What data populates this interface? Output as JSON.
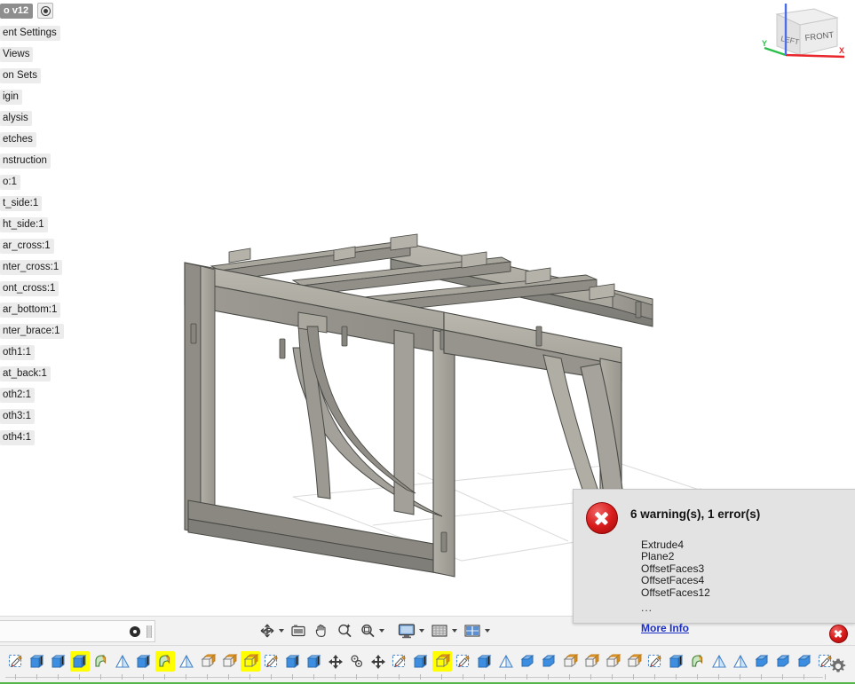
{
  "document": {
    "title": "o v12",
    "version_badge_icon": "record-dot-icon"
  },
  "browser": {
    "items": [
      {
        "label": "ent Settings",
        "icon": "gear-icon"
      },
      {
        "label": "Views",
        "icon": "named-views-icon"
      },
      {
        "label": "on Sets",
        "icon": "selection-sets-icon"
      },
      {
        "label": "igin",
        "icon": "origin-icon"
      },
      {
        "label": "alysis",
        "icon": "analysis-icon"
      },
      {
        "label": "etches",
        "icon": "sketches-icon"
      },
      {
        "label": "nstruction",
        "icon": "construction-icon"
      },
      {
        "label": "o:1",
        "icon": "component-icon"
      },
      {
        "label": "t_side:1",
        "icon": "component-icon"
      },
      {
        "label": "ht_side:1",
        "icon": "component-icon"
      },
      {
        "label": "ar_cross:1",
        "icon": "component-icon"
      },
      {
        "label": "nter_cross:1",
        "icon": "component-icon"
      },
      {
        "label": "ont_cross:1",
        "icon": "component-icon"
      },
      {
        "label": "ar_bottom:1",
        "icon": "component-icon"
      },
      {
        "label": "nter_brace:1",
        "icon": "component-icon"
      },
      {
        "label": "oth1:1",
        "icon": "component-icon"
      },
      {
        "label": "at_back:1",
        "icon": "component-icon"
      },
      {
        "label": "oth2:1",
        "icon": "component-icon"
      },
      {
        "label": "oth3:1",
        "icon": "component-icon"
      },
      {
        "label": "oth4:1",
        "icon": "component-icon"
      }
    ]
  },
  "viewcube": {
    "face_left_label": "LEFT",
    "face_front_label": "FRONT",
    "axis_x_label": "X",
    "axis_y_label": "Y",
    "axis_x_color": "#e8262b",
    "axis_y_color": "#2bbf4a",
    "axis_z_color": "#4a6fe8"
  },
  "error_dialog": {
    "title": "6 warning(s), 1 error(s)",
    "items": [
      "Extrude4",
      "Plane2",
      "OffsetFaces3",
      "OffsetFaces4",
      "OffsetFaces12"
    ],
    "ellipsis": "...",
    "more_info_label": "More Info",
    "badge_icon": "error-x-icon",
    "link_color": "#1b2ec4",
    "error_color": "#d81b1b"
  },
  "status_bar": {
    "error_badge_icon": "error-x-icon"
  },
  "navigation_bar": {
    "buttons": [
      {
        "name": "orbit",
        "icon": "orbit-icon",
        "has_caret": true
      },
      {
        "name": "look-at",
        "icon": "look-at-icon",
        "has_caret": false
      },
      {
        "name": "pan",
        "icon": "pan-hand-icon",
        "has_caret": false
      },
      {
        "name": "zoom",
        "icon": "zoom-magnifier-icon",
        "has_caret": false
      },
      {
        "name": "fit",
        "icon": "fit-magnifier-icon",
        "has_caret": true
      },
      {
        "name": "display-settings",
        "icon": "monitor-icon",
        "has_caret": true
      },
      {
        "name": "grid-and-snaps",
        "icon": "grid-icon",
        "has_caret": true
      },
      {
        "name": "viewports",
        "icon": "viewports-icon",
        "has_caret": true
      }
    ]
  },
  "timeline_panel": {
    "marker_icon": "playhead-icon",
    "resize_handle_icon": "drag-handle-icon"
  },
  "timeline": {
    "settings_icon": "gear-icon",
    "nodes": [
      {
        "icon": "sketch",
        "highlighted": false
      },
      {
        "icon": "extrude",
        "highlighted": false
      },
      {
        "icon": "extrude",
        "highlighted": false
      },
      {
        "icon": "extrude",
        "highlighted": true
      },
      {
        "icon": "fillet",
        "highlighted": false
      },
      {
        "icon": "plane",
        "highlighted": false
      },
      {
        "icon": "extrude",
        "highlighted": false
      },
      {
        "icon": "fillet",
        "highlighted": true
      },
      {
        "icon": "plane",
        "highlighted": false
      },
      {
        "icon": "offsetface",
        "highlighted": false
      },
      {
        "icon": "offsetface",
        "highlighted": false
      },
      {
        "icon": "offsetface",
        "highlighted": true
      },
      {
        "icon": "sketch",
        "highlighted": false
      },
      {
        "icon": "extrude",
        "highlighted": false
      },
      {
        "icon": "extrude",
        "highlighted": false
      },
      {
        "icon": "move",
        "highlighted": false
      },
      {
        "icon": "joint",
        "highlighted": false
      },
      {
        "icon": "move",
        "highlighted": false
      },
      {
        "icon": "sketch",
        "highlighted": false
      },
      {
        "icon": "extrude",
        "highlighted": false
      },
      {
        "icon": "offsetface",
        "highlighted": true
      },
      {
        "icon": "sketch",
        "highlighted": false
      },
      {
        "icon": "extrude",
        "highlighted": false
      },
      {
        "icon": "plane",
        "highlighted": false
      },
      {
        "icon": "chamfer",
        "highlighted": false
      },
      {
        "icon": "chamfer",
        "highlighted": false
      },
      {
        "icon": "offsetface",
        "highlighted": false
      },
      {
        "icon": "offsetface",
        "highlighted": false
      },
      {
        "icon": "offsetface",
        "highlighted": false
      },
      {
        "icon": "offsetface",
        "highlighted": false
      },
      {
        "icon": "sketch",
        "highlighted": false
      },
      {
        "icon": "extrude",
        "highlighted": false
      },
      {
        "icon": "fillet",
        "highlighted": false
      },
      {
        "icon": "plane",
        "highlighted": false
      },
      {
        "icon": "plane",
        "highlighted": false
      },
      {
        "icon": "chamfer",
        "highlighted": false
      },
      {
        "icon": "chamfer",
        "highlighted": false
      },
      {
        "icon": "chamfer",
        "highlighted": false
      },
      {
        "icon": "sketch",
        "highlighted": false
      }
    ]
  },
  "model": {
    "description": "Assembled plywood bench frame shown in shaded isometric view",
    "body_fill": "#9c9a92",
    "body_top_fill": "#b4b1a8",
    "body_dark_fill": "#85847d",
    "edge_color": "#4a4a46",
    "ground_grid_color": "#dcdcdc"
  },
  "accent": {
    "timeline_highlight": "#ffff00",
    "green_bar": "#55b64a"
  }
}
